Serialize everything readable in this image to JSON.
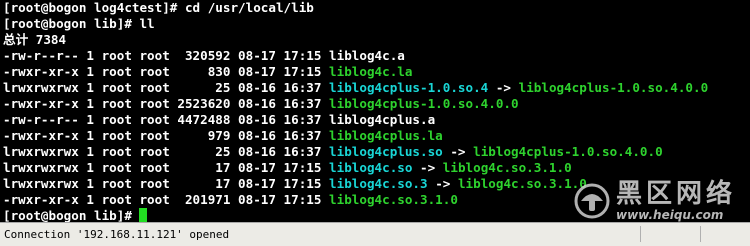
{
  "terminal": {
    "lines": [
      "[root@bogon log4ctest]# cd /usr/local/lib",
      "[root@bogon lib]# ll",
      "总计 7384",
      "-rw-r--r-- 1 root root  320592 08-17 17:15 ",
      "-rwxr-xr-x 1 root root     830 08-17 17:15 ",
      "lrwxrwxrwx 1 root root      25 08-16 16:37 ",
      "-rwxr-xr-x 1 root root 2523620 08-16 16:37 ",
      "-rw-r--r-- 1 root root 4472488 08-16 16:37 ",
      "-rwxr-xr-x 1 root root     979 08-16 16:37 ",
      "lrwxrwxrwx 1 root root      25 08-16 16:37 ",
      "lrwxrwxrwx 1 root root      17 08-17 17:15 ",
      "lrwxrwxrwx 1 root root      17 08-17 17:15 ",
      "-rwxr-xr-x 1 root root  201971 08-17 17:15 ",
      "[root@bogon lib]# "
    ],
    "files": [
      {
        "name": "liblog4c.a",
        "link": ""
      },
      {
        "name": "liblog4c.la",
        "link": ""
      },
      {
        "name": "liblog4cplus-1.0.so.4",
        "link": "liblog4cplus-1.0.so.4.0.0"
      },
      {
        "name": "liblog4cplus-1.0.so.4.0.0",
        "link": ""
      },
      {
        "name": "liblog4cplus.a",
        "link": ""
      },
      {
        "name": "liblog4cplus.la",
        "link": ""
      },
      {
        "name": "liblog4cplus.so",
        "link": "liblog4cplus-1.0.so.4.0.0"
      },
      {
        "name": "liblog4c.so",
        "link": "liblog4c.so.3.1.0"
      },
      {
        "name": "liblog4c.so.3",
        "link": "liblog4c.so.3.1.0"
      },
      {
        "name": "liblog4c.so.3.1.0",
        "link": ""
      }
    ],
    "arrow": " -> ",
    "colors": {
      "background": "#000000",
      "default_text": "#ffffff",
      "symlink": "#19d6d6",
      "executable": "#2ed32e",
      "cursor": "#22dd22"
    }
  },
  "statusbar": {
    "connection_text": "Connection '192.168.11.121' opened"
  },
  "watermark": {
    "name": "黑区网络",
    "url": "www.heiqu.com"
  }
}
